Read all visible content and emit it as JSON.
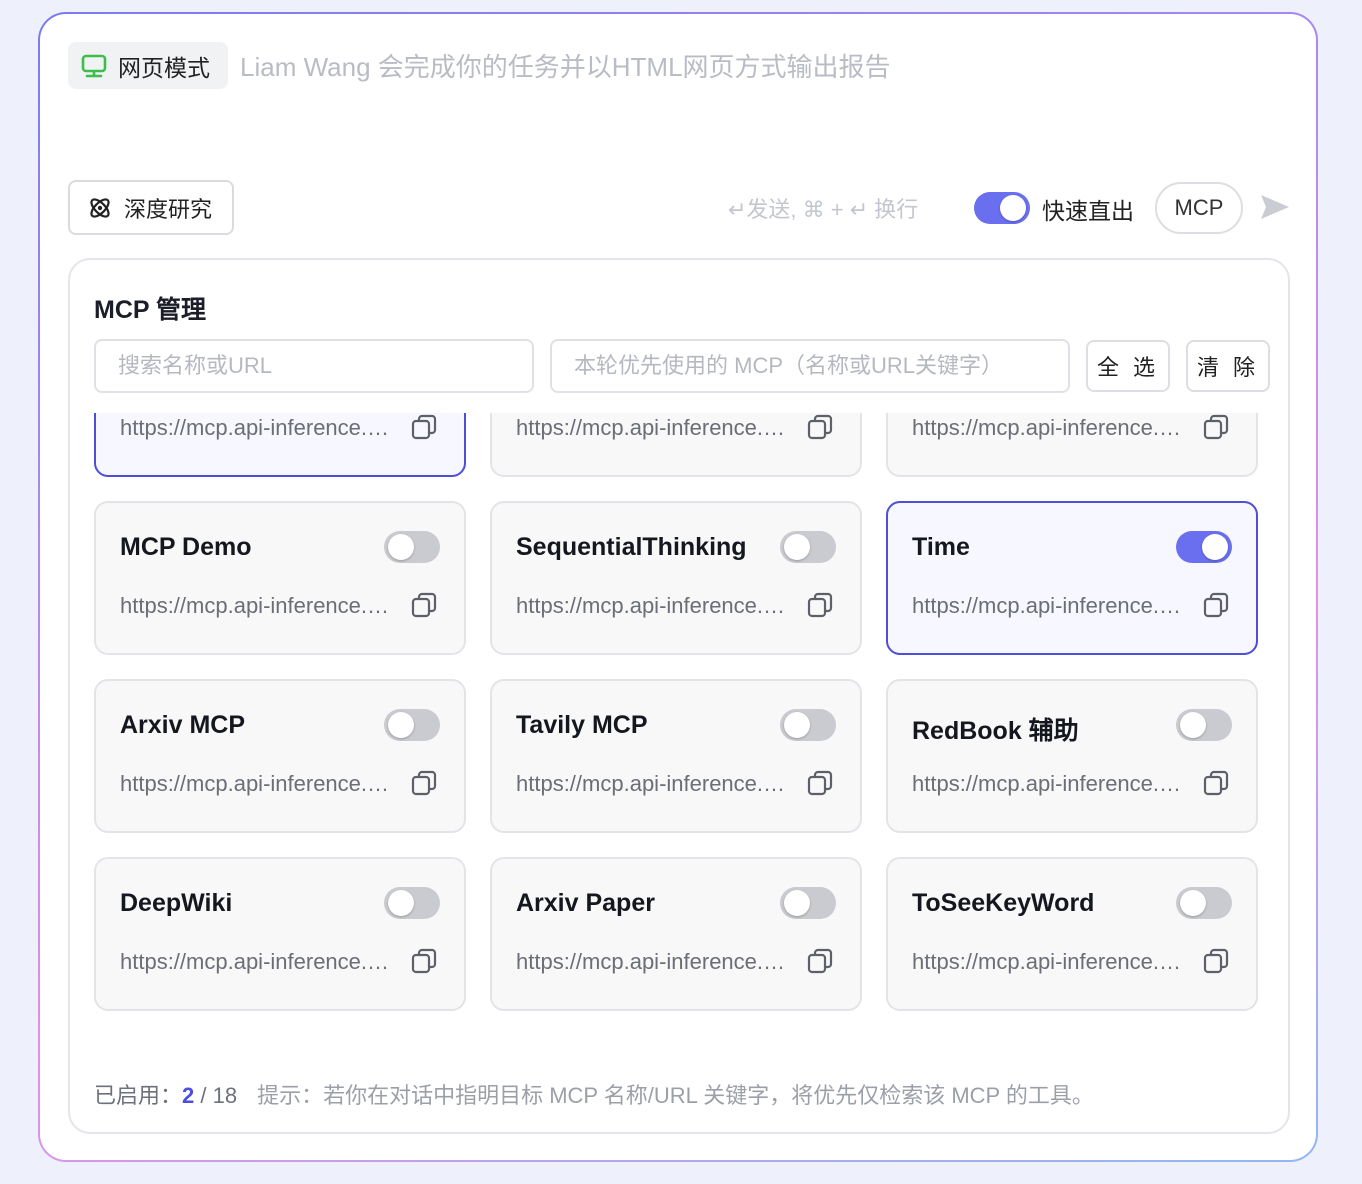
{
  "composer": {
    "mode_label": "网页模式",
    "placeholder": "Liam Wang 会完成你的任务并以HTML网页方式输出报告",
    "deep_research_label": "深度研究",
    "send_hint": "↵发送, ⌘ + ↵ 换行",
    "fast_mode_label": "快速直出",
    "fast_mode_on": true,
    "mcp_button_label": "MCP"
  },
  "mcp_panel": {
    "title": "MCP 管理",
    "search_placeholder": "搜索名称或URL",
    "prefer_placeholder": "本轮优先使用的 MCP（名称或URL关键字）",
    "select_all_label": "全 选",
    "clear_label": "清 除",
    "servers": [
      {
        "name": "",
        "url": "https://mcp.api-inference.modelscope.net/",
        "enabled": true
      },
      {
        "name": "",
        "url": "https://mcp.api-inference.modelscope.net/",
        "enabled": false
      },
      {
        "name": "",
        "url": "https://mcp.api-inference.modelscope.net/",
        "enabled": false
      },
      {
        "name": "MCP Demo",
        "url": "https://mcp.api-inference.modelscope.net/",
        "enabled": false
      },
      {
        "name": "SequentialThinking",
        "url": "https://mcp.api-inference.modelscope.net/",
        "enabled": false
      },
      {
        "name": "Time",
        "url": "https://mcp.api-inference.modelscope.net/",
        "enabled": true
      },
      {
        "name": "Arxiv MCP",
        "url": "https://mcp.api-inference.modelscope.net/",
        "enabled": false
      },
      {
        "name": "Tavily MCP",
        "url": "https://mcp.api-inference.modelscope.net/",
        "enabled": false
      },
      {
        "name": "RedBook 辅助",
        "url": "https://mcp.api-inference.modelscope.net/",
        "enabled": false
      },
      {
        "name": "DeepWiki",
        "url": "https://mcp.api-inference.modelscope.net/",
        "enabled": false
      },
      {
        "name": "Arxiv Paper",
        "url": "https://mcp.api-inference.modelscope.net/",
        "enabled": false
      },
      {
        "name": "ToSeeKeyWord",
        "url": "https://mcp.api-inference.modelscope.net/",
        "enabled": false
      }
    ],
    "footer": {
      "enabled_label": "已启用：",
      "enabled_count": "2",
      "total": " / 18",
      "hint": "提示：若你在对话中指明目标 MCP 名称/URL 关键字，将优先仅检索该 MCP 的工具。"
    }
  },
  "colors": {
    "accent": "#6a6ff0",
    "active_border": "#4e4fd6",
    "monitor_icon": "#3bbf4a"
  }
}
